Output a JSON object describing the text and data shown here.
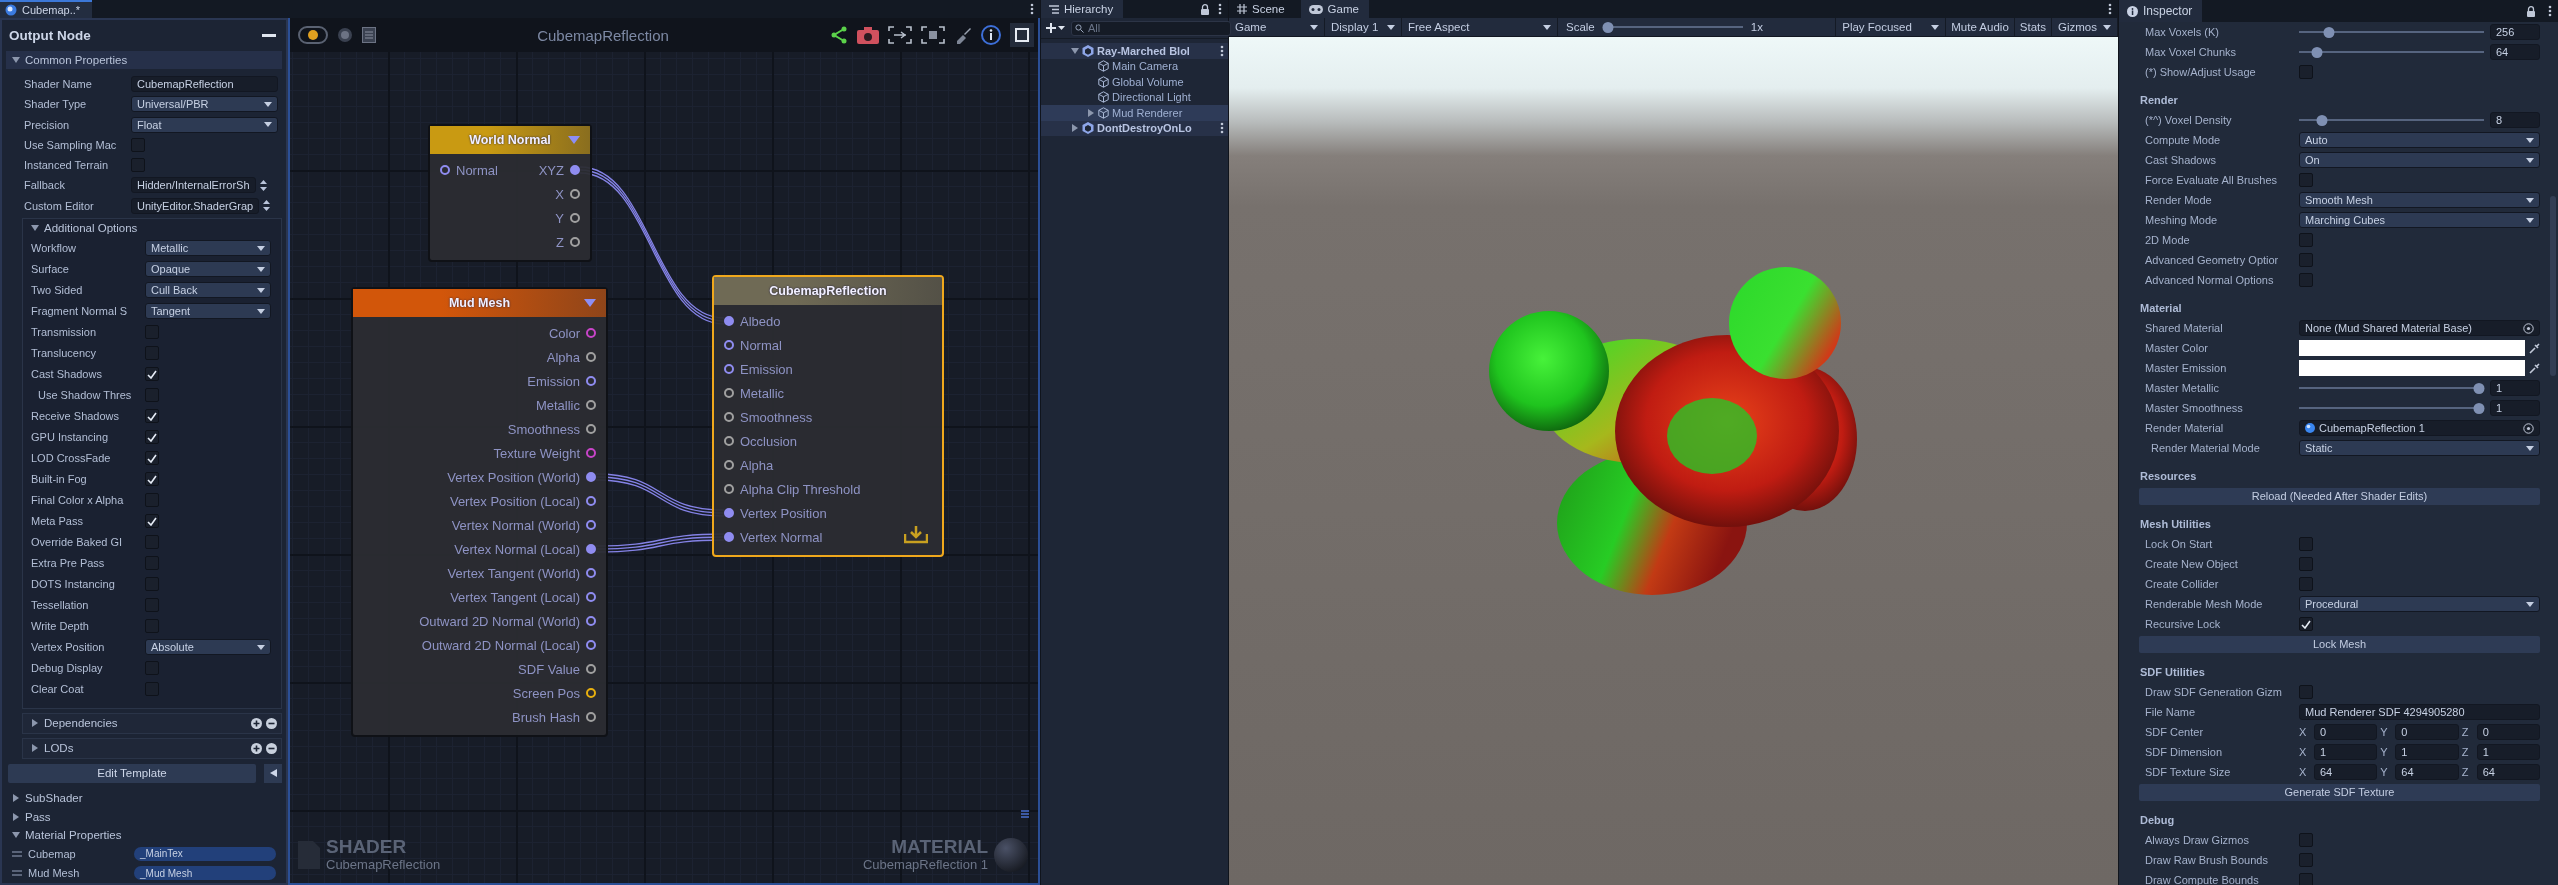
{
  "shader_editor": {
    "tab": "Cubemap..*",
    "output_node": {
      "title": "Output Node",
      "common": {
        "label": "Common Properties",
        "expanded": true,
        "rows": [
          {
            "label": "Shader Name",
            "kind": "text",
            "value": "CubemapReflection"
          },
          {
            "label": "Shader Type",
            "kind": "dropdown",
            "value": "Universal/PBR"
          },
          {
            "label": "Precision",
            "kind": "dropdown",
            "value": "Float"
          },
          {
            "label": "Use Sampling Mac",
            "kind": "checkbox",
            "checked": false
          },
          {
            "label": "Instanced Terrain",
            "kind": "checkbox",
            "checked": false
          },
          {
            "label": "Fallback",
            "kind": "spinner",
            "value": "Hidden/InternalErrorSh"
          },
          {
            "label": "Custom Editor",
            "kind": "spinner",
            "value": "UnityEditor.ShaderGrap"
          }
        ]
      },
      "additional": {
        "label": "Additional Options",
        "expanded": true,
        "rows": [
          {
            "label": "Workflow",
            "kind": "dropdown",
            "value": "Metallic"
          },
          {
            "label": "Surface",
            "kind": "dropdown",
            "value": "Opaque"
          },
          {
            "label": "Two Sided",
            "kind": "dropdown",
            "value": "Cull Back"
          },
          {
            "label": "Fragment Normal S",
            "kind": "dropdown",
            "value": "Tangent"
          },
          {
            "label": "Transmission",
            "kind": "checkbox",
            "checked": false
          },
          {
            "label": "Translucency",
            "kind": "checkbox",
            "checked": false
          },
          {
            "label": "Cast Shadows",
            "kind": "checkbox",
            "checked": true,
            "children": [
              {
                "label": "Use Shadow Thres",
                "kind": "checkbox",
                "checked": false
              }
            ]
          },
          {
            "label": "Receive Shadows",
            "kind": "checkbox",
            "checked": true
          },
          {
            "label": "GPU Instancing",
            "kind": "checkbox",
            "checked": true
          },
          {
            "label": "LOD CrossFade",
            "kind": "checkbox",
            "checked": true
          },
          {
            "label": "Built-in Fog",
            "kind": "checkbox",
            "checked": true
          },
          {
            "label": "Final Color x Alpha",
            "kind": "checkbox",
            "checked": false
          },
          {
            "label": "Meta Pass",
            "kind": "checkbox",
            "checked": true
          },
          {
            "label": "Override Baked GI",
            "kind": "checkbox",
            "checked": false
          },
          {
            "label": "Extra Pre Pass",
            "kind": "checkbox",
            "checked": false
          },
          {
            "label": "DOTS Instancing",
            "kind": "checkbox",
            "checked": false
          },
          {
            "label": "Tessellation",
            "kind": "checkbox",
            "checked": false
          },
          {
            "label": "Write Depth",
            "kind": "checkbox",
            "checked": false
          },
          {
            "label": "Vertex Position",
            "kind": "dropdown",
            "value": "Absolute"
          },
          {
            "label": "Debug Display",
            "kind": "checkbox",
            "checked": false
          },
          {
            "label": "Clear Coat",
            "kind": "checkbox",
            "checked": false
          }
        ]
      },
      "lists": [
        {
          "label": "Dependencies",
          "expanded": false
        },
        {
          "label": "LODs",
          "expanded": false
        }
      ],
      "edit_template": "Edit Template",
      "sections": [
        {
          "label": "SubShader",
          "expanded": false
        },
        {
          "label": "Pass",
          "expanded": false
        },
        {
          "label": "Material Properties",
          "expanded": true,
          "items": [
            {
              "name": "Cubemap",
              "value": "_MainTex"
            },
            {
              "name": "Mud Mesh",
              "value": "_Mud Mesh"
            }
          ]
        }
      ]
    },
    "graph": {
      "title": "CubemapReflection",
      "nodes": [
        {
          "title": "World Normal",
          "kind": "function",
          "color": "#c99a12",
          "selected": false,
          "inputs": [
            {
              "label": "Normal",
              "connected": false,
              "color": "#8f8cf0"
            }
          ],
          "outputs": [
            {
              "label": "XYZ",
              "connected": true,
              "color": "#8f8cf0"
            },
            {
              "label": "X",
              "connected": false,
              "color": "#a0a0a0"
            },
            {
              "label": "Y",
              "connected": false,
              "color": "#a0a0a0"
            },
            {
              "label": "Z",
              "connected": false,
              "color": "#a0a0a0"
            }
          ]
        },
        {
          "title": "Mud Mesh",
          "kind": "function",
          "color": "#d2560a",
          "selected": false,
          "outputs": [
            {
              "label": "Color",
              "connected": false,
              "color": "#c844c8"
            },
            {
              "label": "Alpha",
              "connected": false,
              "color": "#a0a0a0"
            },
            {
              "label": "Emission",
              "connected": false,
              "color": "#8f8cf0"
            },
            {
              "label": "Metallic",
              "connected": false,
              "color": "#a0a0a0"
            },
            {
              "label": "Smoothness",
              "connected": false,
              "color": "#a0a0a0"
            },
            {
              "label": "Texture Weight",
              "connected": false,
              "color": "#c844c8"
            },
            {
              "label": "Vertex Position (World)",
              "connected": true,
              "color": "#8f8cf0"
            },
            {
              "label": "Vertex Position (Local)",
              "connected": false,
              "color": "#8f8cf0"
            },
            {
              "label": "Vertex Normal (World)",
              "connected": false,
              "color": "#8f8cf0"
            },
            {
              "label": "Vertex Normal (Local)",
              "connected": true,
              "color": "#8f8cf0"
            },
            {
              "label": "Vertex Tangent (World)",
              "connected": false,
              "color": "#8f8cf0"
            },
            {
              "label": "Vertex Tangent (Local)",
              "connected": false,
              "color": "#8f8cf0"
            },
            {
              "label": "Outward 2D Normal (World)",
              "connected": false,
              "color": "#8f8cf0"
            },
            {
              "label": "Outward 2D Normal (Local)",
              "connected": false,
              "color": "#8f8cf0"
            },
            {
              "label": "SDF Value",
              "connected": false,
              "color": "#a0a0a0"
            },
            {
              "label": "Screen Pos",
              "connected": false,
              "color": "#e8b00f"
            },
            {
              "label": "Brush Hash",
              "connected": false,
              "color": "#a0a0a0"
            }
          ]
        },
        {
          "title": "CubemapReflection",
          "kind": "output",
          "color": "#6f6a55",
          "selected": true,
          "inputs": [
            {
              "label": "Albedo",
              "connected": true,
              "color": "#8f8cf0"
            },
            {
              "label": "Normal",
              "connected": false,
              "color": "#8f8cf0"
            },
            {
              "label": "Emission",
              "connected": false,
              "color": "#8f8cf0"
            },
            {
              "label": "Metallic",
              "connected": false,
              "color": "#a0a0a0"
            },
            {
              "label": "Smoothness",
              "connected": false,
              "color": "#a0a0a0"
            },
            {
              "label": "Occlusion",
              "connected": false,
              "color": "#a0a0a0"
            },
            {
              "label": "Alpha",
              "connected": false,
              "color": "#a0a0a0"
            },
            {
              "label": "Alpha Clip Threshold",
              "connected": false,
              "color": "#a0a0a0"
            },
            {
              "label": "Vertex Position",
              "connected": true,
              "color": "#8f8cf0"
            },
            {
              "label": "Vertex Normal",
              "connected": true,
              "color": "#8f8cf0"
            }
          ]
        }
      ],
      "shader_label": "SHADER",
      "shader_name": "CubemapReflection",
      "material_label": "MATERIAL",
      "material_name": "CubemapReflection 1"
    }
  },
  "hierarchy": {
    "tab": "Hierarchy",
    "search_placeholder": "All",
    "items": [
      {
        "label": "Ray-Marched Blol",
        "kind": "scene",
        "expanded": true,
        "selected": false,
        "children": [
          {
            "label": "Main Camera",
            "kind": "object",
            "selected": false
          },
          {
            "label": "Global Volume",
            "kind": "object",
            "selected": false
          },
          {
            "label": "Directional Light",
            "kind": "object",
            "selected": false
          },
          {
            "label": "Mud Renderer",
            "kind": "object",
            "expanded": false,
            "selected": true
          }
        ]
      },
      {
        "label": "DontDestroyOnLo",
        "kind": "scene",
        "expanded": false,
        "selected": false
      }
    ]
  },
  "game": {
    "tabs": [
      {
        "label": "Scene",
        "kind": "scene",
        "selected": false
      },
      {
        "label": "Game",
        "kind": "game",
        "selected": true
      }
    ],
    "toolbar": {
      "view": "Game",
      "display": "Display 1",
      "aspect": "Free Aspect",
      "scale": {
        "label": "Scale",
        "level": 0,
        "reading": "1x"
      },
      "play_mode": "Play Focused",
      "toggles": [
        {
          "label": "Mute Audio",
          "on": false
        },
        {
          "label": "Stats",
          "on": false
        }
      ],
      "gizmos": "Gizmos"
    }
  },
  "inspector": {
    "tab": "Inspector",
    "items": [
      {
        "kind": "slider",
        "label": "Max Voxels (K)",
        "level": 0.14,
        "value": "256"
      },
      {
        "kind": "slider",
        "label": "Max Voxel Chunks",
        "level": 0.07,
        "value": "64"
      },
      {
        "kind": "checkbox",
        "label": "(*) Show/Adjust Usage",
        "checked": false
      },
      {
        "kind": "heading",
        "label": "Render"
      },
      {
        "kind": "slider",
        "label": "(*^) Voxel Density",
        "level": 0.1,
        "value": "8"
      },
      {
        "kind": "dropdown",
        "label": "Compute Mode",
        "value": "Auto"
      },
      {
        "kind": "dropdown",
        "label": "Cast Shadows",
        "value": "On"
      },
      {
        "kind": "checkbox",
        "label": "Force Evaluate All Brushes",
        "checked": false
      },
      {
        "kind": "dropdown",
        "label": "Render Mode",
        "value": "Smooth Mesh"
      },
      {
        "kind": "dropdown",
        "label": "Meshing Mode",
        "value": "Marching Cubes"
      },
      {
        "kind": "checkbox",
        "label": "2D Mode",
        "checked": false
      },
      {
        "kind": "checkbox",
        "label": "Advanced Geometry Optior",
        "checked": false
      },
      {
        "kind": "checkbox",
        "label": "Advanced Normal Options",
        "checked": false
      },
      {
        "kind": "heading",
        "label": "Material"
      },
      {
        "kind": "object",
        "label": "Shared Material",
        "value": "None (Mud Shared Material Base)",
        "assigned": false
      },
      {
        "kind": "color",
        "label": "Master Color",
        "color": "#ffffff"
      },
      {
        "kind": "color",
        "label": "Master Emission",
        "color": "#ffffff"
      },
      {
        "kind": "slider",
        "label": "Master Metallic",
        "level": 1,
        "value": "1"
      },
      {
        "kind": "slider",
        "label": "Master Smoothness",
        "level": 1,
        "value": "1"
      },
      {
        "kind": "object",
        "label": "Render Material",
        "value": "CubemapReflection 1",
        "assigned": true,
        "children": [
          {
            "kind": "dropdown",
            "label": "Render Material Mode",
            "value": "Static"
          }
        ]
      },
      {
        "kind": "heading",
        "label": "Resources"
      },
      {
        "kind": "button",
        "label": "Reload (Needed After Shader Edits)"
      },
      {
        "kind": "heading",
        "label": "Mesh Utilities"
      },
      {
        "kind": "checkbox",
        "label": "Lock On Start",
        "checked": false
      },
      {
        "kind": "checkbox",
        "label": "Create New Object",
        "checked": false
      },
      {
        "kind": "checkbox",
        "label": "Create Collider",
        "checked": false
      },
      {
        "kind": "dropdown",
        "label": "Renderable Mesh Mode",
        "value": "Procedural"
      },
      {
        "kind": "checkbox",
        "label": "Recursive Lock",
        "checked": true
      },
      {
        "kind": "button",
        "label": "Lock Mesh"
      },
      {
        "kind": "heading",
        "label": "SDF Utilities"
      },
      {
        "kind": "checkbox",
        "label": "Draw SDF Generation Gizm",
        "checked": false
      },
      {
        "kind": "text",
        "label": "File Name",
        "value": "Mud Renderer SDF 4294905280"
      },
      {
        "kind": "vector3",
        "label": "SDF Center",
        "axes": [
          {
            "axis": "X",
            "value": "0"
          },
          {
            "axis": "Y",
            "value": "0"
          },
          {
            "axis": "Z",
            "value": "0"
          }
        ]
      },
      {
        "kind": "vector3",
        "label": "SDF Dimension",
        "axes": [
          {
            "axis": "X",
            "value": "1"
          },
          {
            "axis": "Y",
            "value": "1"
          },
          {
            "axis": "Z",
            "value": "1"
          }
        ]
      },
      {
        "kind": "vector3",
        "label": "SDF Texture Size",
        "axes": [
          {
            "axis": "X",
            "value": "64"
          },
          {
            "axis": "Y",
            "value": "64"
          },
          {
            "axis": "Z",
            "value": "64"
          }
        ]
      },
      {
        "kind": "button",
        "label": "Generate SDF Texture"
      },
      {
        "kind": "heading",
        "label": "Debug"
      },
      {
        "kind": "checkbox",
        "label": "Always Draw Gizmos",
        "checked": false
      },
      {
        "kind": "checkbox",
        "label": "Draw Raw Brush Bounds",
        "checked": false
      },
      {
        "kind": "checkbox",
        "label": "Draw Compute Bounds",
        "checked": false
      }
    ]
  }
}
